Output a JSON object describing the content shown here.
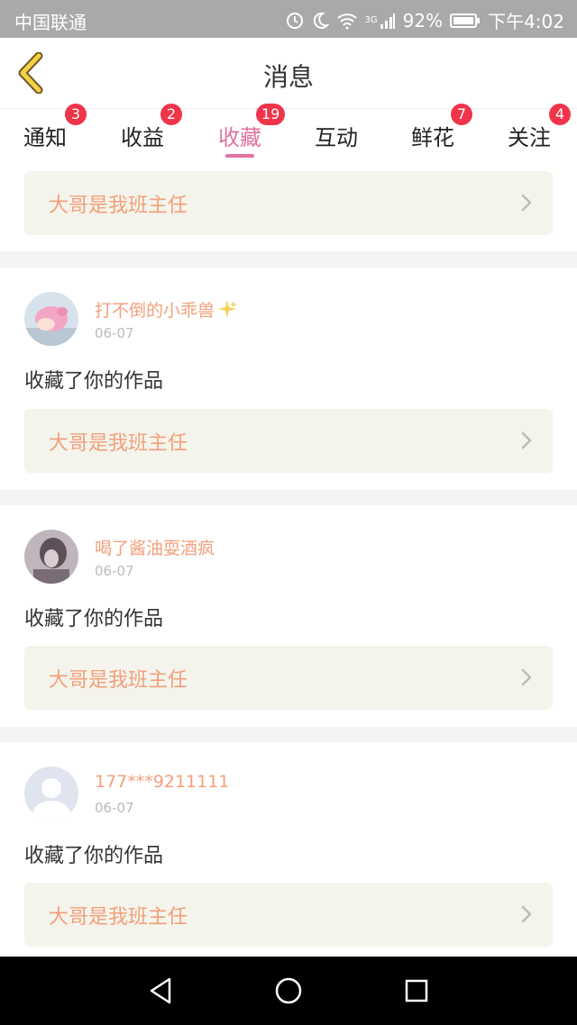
{
  "status_bar": {
    "carrier": "中国联通",
    "network": "3G",
    "battery": "92%",
    "time": "下午4:02"
  },
  "header": {
    "title": "消息",
    "back_icon": "chevron-left-icon"
  },
  "tabs": [
    {
      "label": "通知",
      "badge": "3",
      "active": false
    },
    {
      "label": "收益",
      "badge": "2",
      "active": false
    },
    {
      "label": "收藏",
      "badge": "19",
      "active": true
    },
    {
      "label": "互动",
      "badge": "",
      "active": false
    },
    {
      "label": "鲜花",
      "badge": "7",
      "active": false
    },
    {
      "label": "关注",
      "badge": "4",
      "active": false
    }
  ],
  "top_card": {
    "work_title": "大哥是我班主任"
  },
  "items": [
    {
      "username": "打不倒的小乖兽",
      "date": "06-07",
      "action": "收藏了你的作品",
      "work_title": "大哥是我班主任",
      "avatar": "anime-girl-avatar"
    },
    {
      "username": "喝了酱油耍酒疯",
      "date": "06-07",
      "action": "收藏了你的作品",
      "work_title": "大哥是我班主任",
      "avatar": "photo-avatar"
    },
    {
      "username": "177***9211111",
      "date": "06-07",
      "action": "收藏了你的作品",
      "work_title": "大哥是我班主任",
      "avatar": "default-person-avatar"
    }
  ],
  "colors": {
    "accent": "#e2729f",
    "badge": "#f0344a",
    "username": "#f2a07b",
    "work_box": "#f4f4ec"
  }
}
